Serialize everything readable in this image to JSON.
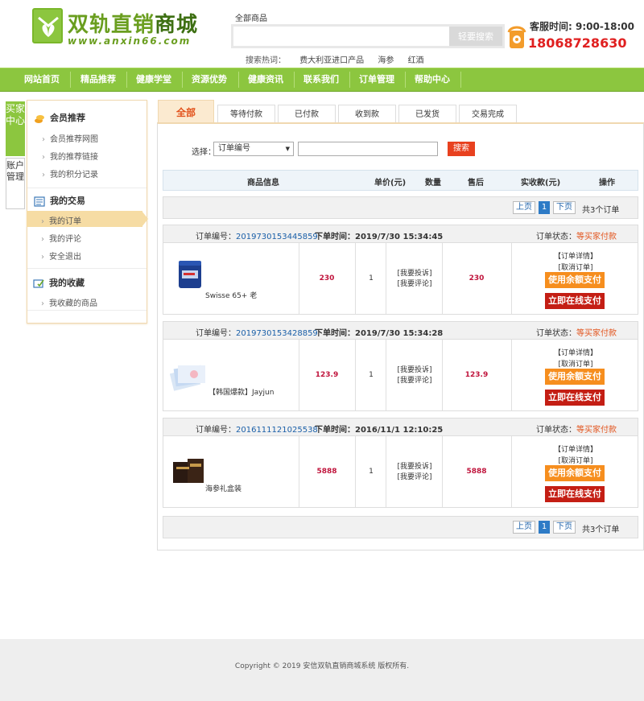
{
  "header": {
    "logo_title_a": "双轨直销",
    "logo_title_b": "商城",
    "logo_url": "www.anxin66.com",
    "search_scope": "全部商品",
    "search_placeholder": "",
    "search_button": "轻要搜索",
    "hot_label": "搜索热词：",
    "hot_keywords": [
      "费大利亚进口产品",
      "海参",
      "红酒"
    ],
    "service_time": "客服时间: 9:00-18:00",
    "service_phone": "18068728630"
  },
  "nav": {
    "items": [
      "网站首页",
      "精品推荐",
      "健康学堂",
      "资源优势",
      "健康资讯",
      "联系我们",
      "订单管理",
      "帮助中心"
    ]
  },
  "side_tabs": {
    "buyer": "买家中心",
    "account": "账户管理"
  },
  "sidebar": {
    "sections": [
      {
        "title": "会员推荐",
        "icon": "coins-icon",
        "links": [
          "会员推荐网图",
          "我的推荐链接",
          "我的积分记录"
        ]
      },
      {
        "title": "我的交易",
        "icon": "list-icon",
        "links": [
          "我的订单",
          "我的评论",
          "安全退出"
        ]
      },
      {
        "title": "我的收藏",
        "icon": "favorite-icon",
        "links": [
          "我收藏的商品"
        ]
      }
    ],
    "active_link": "我的订单"
  },
  "tabs": [
    "全部",
    "等待付款",
    "已付款",
    "收到款",
    "已发货",
    "交易完成"
  ],
  "active_tab": "全部",
  "filter": {
    "label": "选择：",
    "select_value": "订单编号",
    "button": "搜索"
  },
  "table_headers": {
    "product": "商品信息",
    "unit_price": "单价(元)",
    "qty": "数量",
    "after_sale": "售后",
    "paid": "实收款(元)",
    "action": "操作"
  },
  "pager": {
    "prev": "上页",
    "current": "1",
    "next": "下页",
    "total": "共3个订单"
  },
  "order_labels": {
    "order_no": "订单编号：",
    "order_time": "下单时间：",
    "status": "订单状态：",
    "detail": "【订单详情】",
    "cancel": "[取消订单]",
    "complain": "[我要投诉]",
    "review": "[我要评论]",
    "pay_balance": "使用余额支付",
    "pay_online": "立即在线支付"
  },
  "orders": [
    {
      "no": "2019730153445859",
      "time": "2019/7/30 15:34:45",
      "status": "等买家付款",
      "product": "Swisse 65+ 老",
      "unit_price": "230",
      "qty": "1",
      "paid": "230"
    },
    {
      "no": "2019730153428859",
      "time": "2019/7/30 15:34:28",
      "status": "等买家付款",
      "product": "【韩国爆款】Jayjun",
      "unit_price": "123.9",
      "qty": "1",
      "paid": "123.9"
    },
    {
      "no": "2016111121025538",
      "time": "2016/11/1 12:10:25",
      "status": "等买家付款",
      "product": "海参礼盒装",
      "unit_price": "5888",
      "qty": "1",
      "paid": "5888"
    }
  ],
  "footer": {
    "copyright": "Copyright © 2019 安信双轨直销商城系统 版权所有."
  },
  "colors": {
    "brand_green": "#8cc63f",
    "accent_orange": "#e2521b",
    "pay_orange": "#f68e1e",
    "pay_red": "#c41e14"
  }
}
